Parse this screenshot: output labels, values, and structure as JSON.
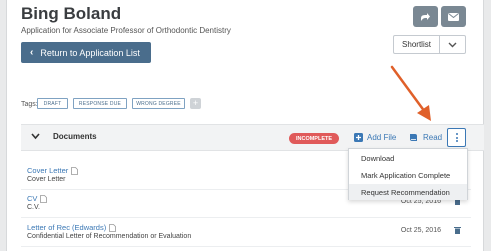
{
  "header": {
    "name": "Bing Boland",
    "subtitle": "Application for Associate Professor of Orthodontic Dentistry",
    "return_label": "Return to Application List",
    "shortlist_label": "Shortlist"
  },
  "tags": {
    "label": "Tags:",
    "items": [
      "DRAFT",
      "RESPONSE DUE",
      "WRONG DEGREE"
    ],
    "add_symbol": "+"
  },
  "documents": {
    "title": "Documents",
    "status_badge": "INCOMPLETE",
    "add_file_label": "Add File",
    "read_label": "Read",
    "rows": [
      {
        "title": "Cover Letter",
        "subtitle": "Cover Letter",
        "date": ""
      },
      {
        "title": "CV",
        "subtitle": "C.V.",
        "date": "Oct 25, 2016"
      },
      {
        "title": "Letter of Rec (Edwards)",
        "subtitle": "Confidential Letter of Recommendation or Evaluation",
        "date": "Oct 25, 2016"
      }
    ]
  },
  "menu": {
    "items": [
      "Download",
      "Mark Application Complete",
      "Request Recommendation"
    ]
  },
  "colors": {
    "primary_button": "#4a6d8c",
    "icon_button": "#7a8893",
    "link": "#3b78b5",
    "incomplete": "#e05a5a",
    "annotation_arrow": "#e0602a"
  },
  "icons": {
    "share": "share-arrow-icon",
    "email": "envelope-icon",
    "back": "chevron-left-icon",
    "caret": "chevron-down-icon",
    "add": "plus-square-icon",
    "read": "book-icon",
    "more": "vertical-ellipsis-icon",
    "file": "file-icon",
    "delete": "trash-icon"
  }
}
